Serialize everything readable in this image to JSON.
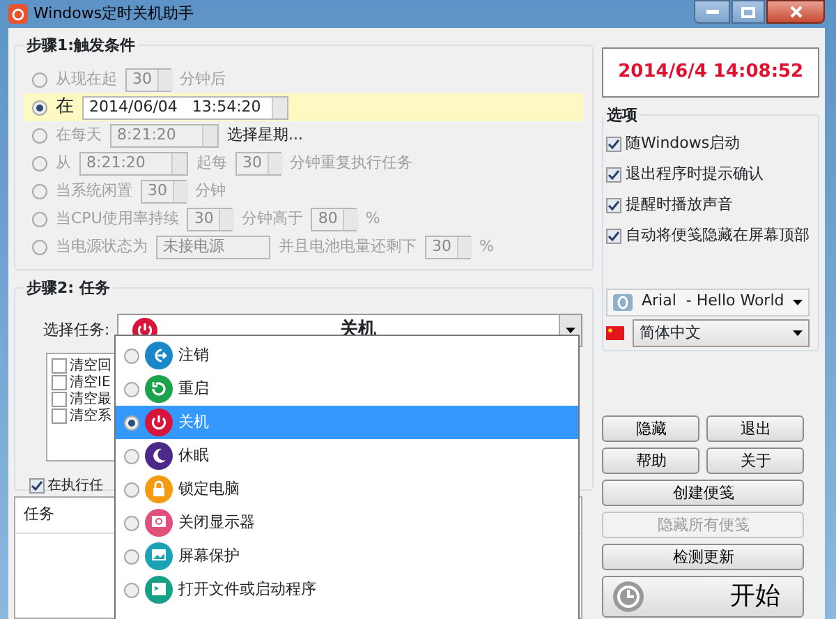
{
  "window": {
    "title": "Windows定时关机助手"
  },
  "step1": {
    "title": "步骤1:触发条件",
    "conditions": [
      {
        "selected": false,
        "parts": [
          {
            "kind": "text",
            "text": "从现在起"
          },
          {
            "kind": "spin",
            "value": "30"
          },
          {
            "kind": "text",
            "text": "分钟后"
          }
        ]
      },
      {
        "selected": true,
        "parts": [
          {
            "kind": "text",
            "text": "在"
          },
          {
            "kind": "datetime",
            "value": "2014/06/04   13:54:20"
          }
        ]
      },
      {
        "selected": false,
        "parts": [
          {
            "kind": "text",
            "text": "在每天"
          },
          {
            "kind": "time",
            "value": "8:21:20"
          },
          {
            "kind": "link",
            "text": "选择星期..."
          }
        ]
      },
      {
        "selected": false,
        "parts": [
          {
            "kind": "text",
            "text": "从"
          },
          {
            "kind": "time",
            "value": "8:21:20"
          },
          {
            "kind": "text",
            "text": "起每"
          },
          {
            "kind": "spin",
            "value": "30"
          },
          {
            "kind": "text",
            "text": "分钟重复执行任务"
          }
        ]
      },
      {
        "selected": false,
        "parts": [
          {
            "kind": "text",
            "text": "当系统闲置"
          },
          {
            "kind": "spin",
            "value": "30"
          },
          {
            "kind": "text",
            "text": "分钟"
          }
        ]
      },
      {
        "selected": false,
        "parts": [
          {
            "kind": "text",
            "text": "当CPU使用率持续"
          },
          {
            "kind": "spin",
            "value": "30"
          },
          {
            "kind": "text",
            "text": "分钟高于"
          },
          {
            "kind": "spin",
            "value": "80"
          },
          {
            "kind": "text",
            "text": "%"
          }
        ]
      },
      {
        "selected": false,
        "parts": [
          {
            "kind": "text",
            "text": "当电源状态为"
          },
          {
            "kind": "select",
            "value": "未接电源"
          },
          {
            "kind": "text",
            "text": "并且电池电量还剩下"
          },
          {
            "kind": "spin",
            "value": "30"
          },
          {
            "kind": "text",
            "text": "%"
          }
        ]
      }
    ]
  },
  "step2": {
    "title": "步骤2: 任务",
    "label": "选择任务:",
    "task": "关机",
    "extras": [
      {
        "label": "清空回",
        "checked": false
      },
      {
        "label": "清空IE",
        "checked": false
      },
      {
        "label": "清空最",
        "checked": false
      },
      {
        "label": "清空系",
        "checked": false
      }
    ],
    "confirm": {
      "label": "在执行任",
      "checked": true
    }
  },
  "dropdown": [
    {
      "label": "注销",
      "kind": "logout",
      "color": "#1b87c9",
      "selected": false
    },
    {
      "label": "重启",
      "kind": "restart",
      "color": "#1aa34a",
      "selected": false
    },
    {
      "label": "关机",
      "kind": "power",
      "color": "#d8143a",
      "selected": true
    },
    {
      "label": "休眠",
      "kind": "moon",
      "color": "#4b2a8c",
      "selected": false
    },
    {
      "label": "锁定电脑",
      "kind": "lock",
      "color": "#f39c12",
      "selected": false
    },
    {
      "label": "关闭显示器",
      "kind": "monitor",
      "color": "#e0507a",
      "selected": false
    },
    {
      "label": "屏幕保护",
      "kind": "screen",
      "color": "#1ba3b5",
      "selected": false
    },
    {
      "label": "打开文件或启动程序",
      "kind": "program",
      "color": "#16a085",
      "selected": false
    }
  ],
  "tasks_table": {
    "columns": [
      "任务"
    ]
  },
  "clock": "2014/6/4 14:08:52",
  "options": {
    "title": "选项",
    "items": [
      {
        "label": "随Windows启动",
        "checked": true
      },
      {
        "label": "退出程序时提示确认",
        "checked": true
      },
      {
        "label": "提醒时播放声音",
        "checked": true
      },
      {
        "label": "自动将便笺隐藏在屏幕顶部",
        "checked": true
      }
    ],
    "font": "Arial  - Hello World",
    "language": "简体中文"
  },
  "buttons": [
    {
      "label": "隐藏",
      "kind": "half",
      "disabled": false
    },
    {
      "label": "退出",
      "kind": "half",
      "disabled": false
    },
    {
      "label": "帮助",
      "kind": "half",
      "disabled": false
    },
    {
      "label": "关于",
      "kind": "half",
      "disabled": false
    },
    {
      "label": "创建便笺",
      "kind": "full",
      "disabled": false
    },
    {
      "label": "隐藏所有便笺",
      "kind": "full",
      "disabled": true
    },
    {
      "label": "检测更新",
      "kind": "full",
      "disabled": false
    },
    {
      "label": "开始",
      "kind": "start",
      "disabled": false
    }
  ]
}
